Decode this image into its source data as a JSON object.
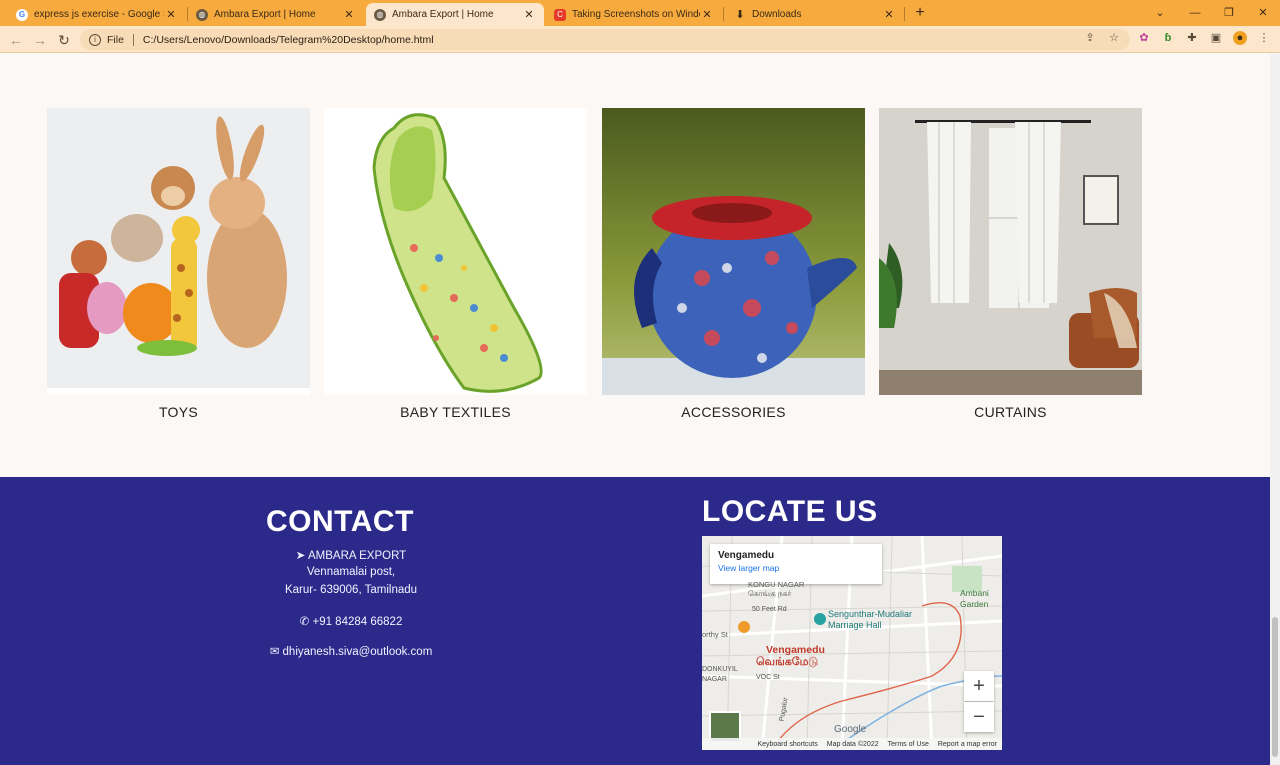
{
  "browser": {
    "tabs": [
      {
        "title": "express js exercise - Google Sear",
        "icon": "google-icon"
      },
      {
        "title": "Ambara Export | Home",
        "icon": "globe-icon"
      },
      {
        "title": "Ambara Export | Home",
        "icon": "globe-icon",
        "active": true
      },
      {
        "title": "Taking Screenshots on Windows",
        "icon": "red-app-icon"
      },
      {
        "title": "Downloads",
        "icon": "download-icon"
      }
    ],
    "address_prefix": "File",
    "url": "C:/Users/Lenovo/Downloads/Telegram%20Desktop/home.html"
  },
  "categories": [
    {
      "label": "TOYS"
    },
    {
      "label": "BABY TEXTILES"
    },
    {
      "label": "ACCESSORIES"
    },
    {
      "label": "CURTAINS"
    }
  ],
  "contact": {
    "title": "CONTACT",
    "company": "AMBARA EXPORT",
    "address1": "Vennamalai post,",
    "address2": "Karur- 639006, Tamilnadu",
    "phone": "+91 84284 66822",
    "email": "dhiyanesh.siva@outlook.com"
  },
  "locate": {
    "title": "LOCATE US",
    "map": {
      "place": "Vengamedu",
      "link": "View larger map",
      "labels": {
        "kongu": "KONGU NAGAR",
        "kongu_ta": "கொங்கு நகர்",
        "feet": "50 Feet Rd",
        "hall1": "Sengunthar-Mudaliar",
        "hall2": "Marriage Hall",
        "ambani1": "Ambani",
        "ambani2": "Garden",
        "north": "orthy St",
        "vengamedu": "Vengamedu",
        "vengamedu_ta": "வெங்கமேடு",
        "donkuyil": "DONKUYIL",
        "nagar": "NAGAR",
        "voc": "VOC St",
        "pugalur": "Pugalur",
        "google": "Google"
      },
      "attribution": [
        "Keyboard shortcuts",
        "Map data ©2022",
        "Terms of Use",
        "Report a map error"
      ]
    }
  }
}
